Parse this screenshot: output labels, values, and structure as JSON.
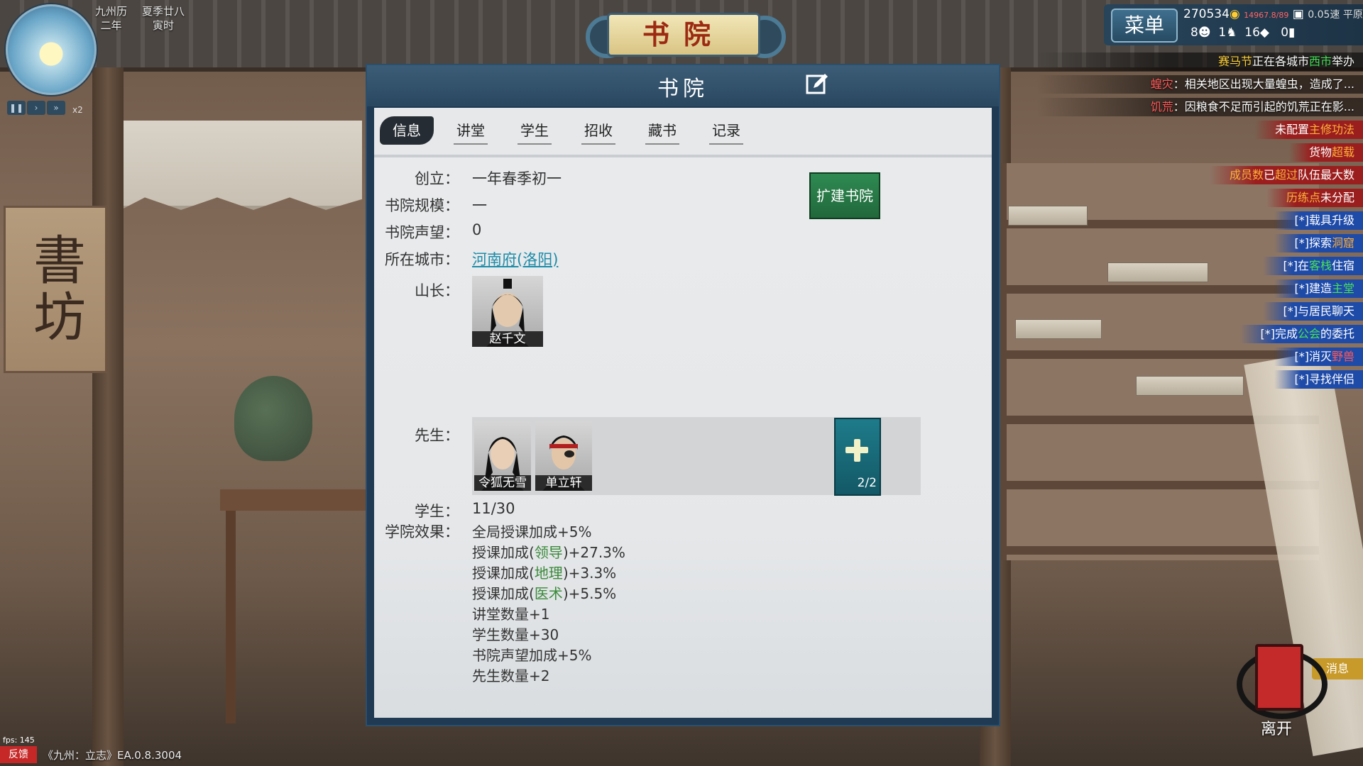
{
  "calendar": {
    "region": "九州历",
    "year": "二年",
    "season_day": "夏季廿八",
    "hour": "寅时",
    "speed_mult": "x2"
  },
  "title_banner": "书院",
  "top_bar": {
    "menu_label": "菜单",
    "money": "270534",
    "weight": "14967.8/89",
    "speed": "0.05速 平原",
    "count_a": "8",
    "count_b": "1",
    "count_c": "16",
    "count_d": "0"
  },
  "notifications": {
    "n1": {
      "a": "赛马节",
      "b": "正在各城市",
      "c": "西市",
      "d": "举办"
    },
    "n2": {
      "a": "蝗灾",
      "b": "：相关地区出现大量蝗虫，造成了..."
    },
    "n3": {
      "a": "饥荒",
      "b": "：因粮食不足而引起的饥荒正在影..."
    },
    "n4": {
      "a": "未配置",
      "b": "主修功法"
    },
    "n5": {
      "a": "货物",
      "b": "超载"
    },
    "n6": {
      "a": "成员数",
      "b": "已",
      "c": "超过",
      "d": "队伍最大数"
    },
    "n7": {
      "a": "历练点",
      "b": "未分配"
    },
    "n8": {
      "a": "[*]",
      "b": "载具",
      "c": "升级"
    },
    "n9": {
      "a": "[*]",
      "b": "探索",
      "c": "洞窟"
    },
    "n10": {
      "a": "[*]在",
      "b": "客栈",
      "c": "住宿"
    },
    "n11": {
      "a": "[*]",
      "b": "建造",
      "c": "主堂"
    },
    "n12": {
      "a": "[*]与",
      "b": "居民",
      "c": "聊天"
    },
    "n13": {
      "a": "[*]完成",
      "b": "公会",
      "c": "的委托"
    },
    "n14": {
      "a": "[*]",
      "b": "消灭",
      "c": "野兽"
    },
    "n15": {
      "a": "[*]",
      "b": "寻找",
      "c": "伴侣"
    }
  },
  "panel": {
    "title": "书院",
    "tabs": [
      "信息",
      "讲堂",
      "学生",
      "招收",
      "藏书",
      "记录"
    ],
    "active_tab": "信息",
    "founded_label": "创立：",
    "founded_value": "一年春季初一",
    "scale_label": "书院规模：",
    "scale_value": "一",
    "reputation_label": "书院声望：",
    "reputation_value": "0",
    "city_label": "所在城市：",
    "city_value": "河南府(洛阳)",
    "head_label": "山长：",
    "head_name": "赵千文",
    "teachers_label": "先生：",
    "teachers": [
      "令狐无雪",
      "单立轩"
    ],
    "teacher_slots": "2/2",
    "students_label": "学生：",
    "students_value": "11/30",
    "effects_label": "学院效果：",
    "effect1": "全局授课加成+5%",
    "effect2": {
      "pre": "授课加成(",
      "skill": "领导",
      "post": ")+27.3%"
    },
    "effect3": {
      "pre": "授课加成(",
      "skill": "地理",
      "post": ")+3.3%"
    },
    "effect4": {
      "pre": "授课加成(",
      "skill": "医术",
      "post": ")+5.5%"
    },
    "effect5": "讲堂数量+1",
    "effect6": "学生数量+30",
    "effect7": "书院声望加成+5%",
    "effect8": "先生数量+2",
    "expand_label": "扩建书院"
  },
  "leave_label": "离开",
  "message_label": "消息",
  "fps": "fps: 145",
  "feedback_label": "反馈",
  "version": "《九州：立志》EA.0.8.3004",
  "sign_text": "書坊",
  "colors": {
    "accent_green": "#2f8a52",
    "panel_blue": "#1f3a52",
    "link": "#1c8ca8",
    "skill_green": "#3a8a3a"
  }
}
